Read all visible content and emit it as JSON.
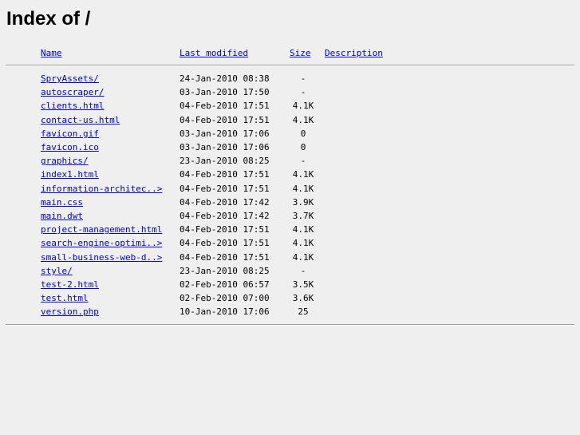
{
  "page": {
    "title": "Index of /"
  },
  "columns": {
    "name": "Name",
    "last_modified": "Last modified",
    "size": "Size",
    "description": "Description"
  },
  "colors": {
    "background": "#efefef",
    "link": "#0000cc",
    "text": "#000000",
    "rule": "#9a9a9a"
  },
  "rows": [
    {
      "name": "SpryAssets/",
      "date": "24-Jan-2010 08:38",
      "size": "-"
    },
    {
      "name": "autoscraper/",
      "date": "03-Jan-2010 17:50",
      "size": "-"
    },
    {
      "name": "clients.html",
      "date": "04-Feb-2010 17:51",
      "size": "4.1K"
    },
    {
      "name": "contact-us.html",
      "date": "04-Feb-2010 17:51",
      "size": "4.1K"
    },
    {
      "name": "favicon.gif",
      "date": "03-Jan-2010 17:06",
      "size": "0"
    },
    {
      "name": "favicon.ico",
      "date": "03-Jan-2010 17:06",
      "size": "0"
    },
    {
      "name": "graphics/",
      "date": "23-Jan-2010 08:25",
      "size": "-"
    },
    {
      "name": "index1.html",
      "date": "04-Feb-2010 17:51",
      "size": "4.1K"
    },
    {
      "name": "information-architec..>",
      "date": "04-Feb-2010 17:51",
      "size": "4.1K"
    },
    {
      "name": "main.css",
      "date": "04-Feb-2010 17:42",
      "size": "3.9K"
    },
    {
      "name": "main.dwt",
      "date": "04-Feb-2010 17:42",
      "size": "3.7K"
    },
    {
      "name": "project-management.html",
      "date": "04-Feb-2010 17:51",
      "size": "4.1K"
    },
    {
      "name": "search-engine-optimi..>",
      "date": "04-Feb-2010 17:51",
      "size": "4.1K"
    },
    {
      "name": "small-business-web-d..>",
      "date": "04-Feb-2010 17:51",
      "size": "4.1K"
    },
    {
      "name": "style/",
      "date": "23-Jan-2010 08:25",
      "size": "-"
    },
    {
      "name": "test-2.html",
      "date": "02-Feb-2010 06:57",
      "size": "3.5K"
    },
    {
      "name": "test.html",
      "date": "02-Feb-2010 07:00",
      "size": "3.6K"
    },
    {
      "name": "version.php",
      "date": "10-Jan-2010 17:06",
      "size": "25"
    }
  ]
}
